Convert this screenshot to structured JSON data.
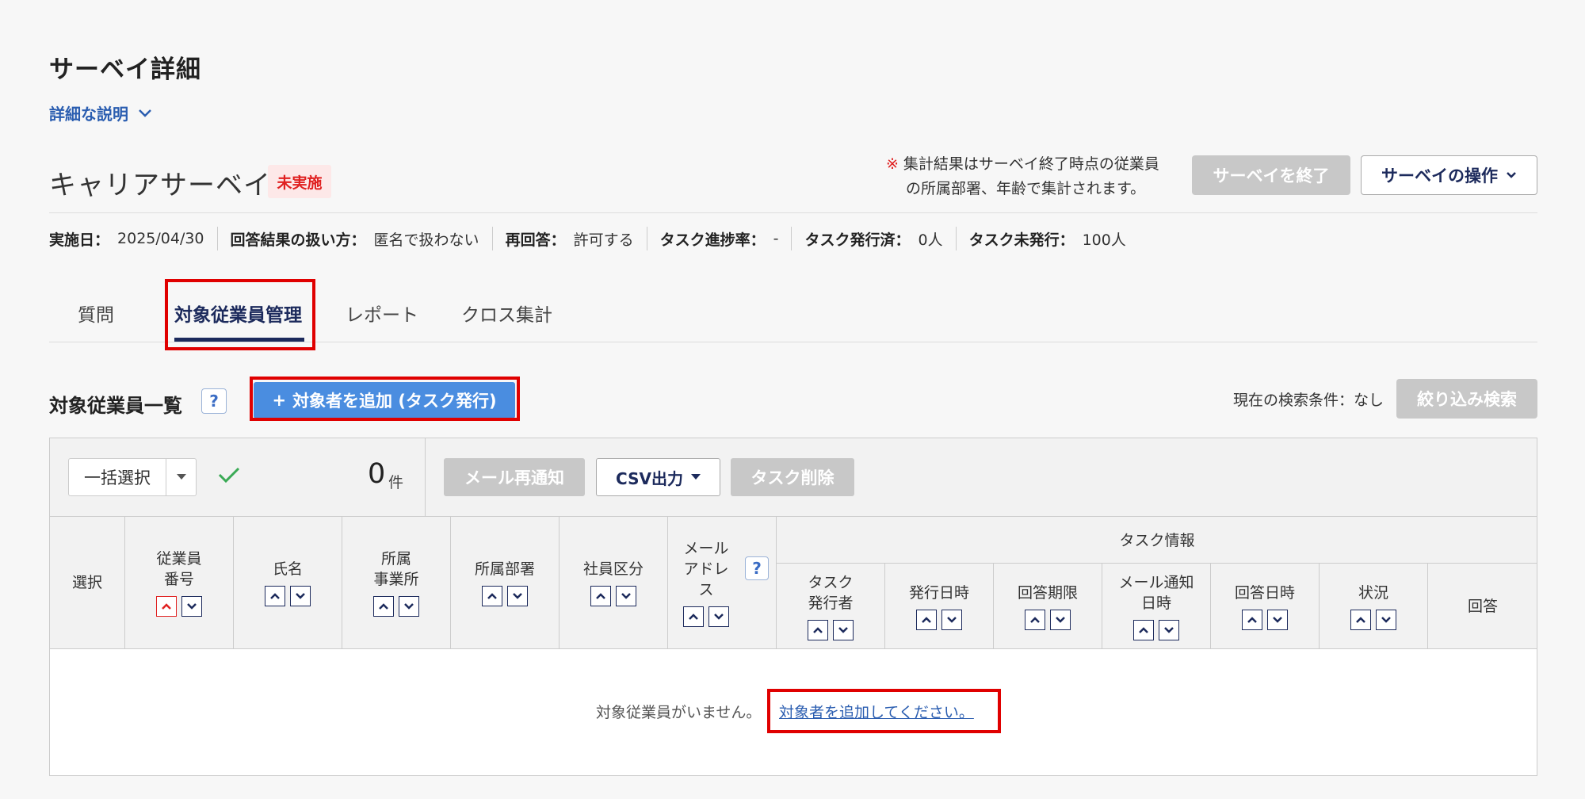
{
  "page": {
    "title": "サーベイ詳細",
    "description_toggle": "詳細な説明"
  },
  "survey": {
    "name": "キャリアサーベイ",
    "status": "未実施",
    "note_mark": "※",
    "note_line1": "集計結果はサーベイ終了時点の従業員",
    "note_line2": "の所属部署、年齢で集計されます。",
    "end_button": "サーベイを終了",
    "ops_button": "サーベイの操作"
  },
  "info": {
    "date_label": "実施日：",
    "date_value": "2025/04/30",
    "handling_label": "回答結果の扱い方：",
    "handling_value": "匿名で扱わない",
    "reanswer_label": "再回答：",
    "reanswer_value": "許可する",
    "progress_label": "タスク進捗率：",
    "progress_value": "-",
    "issued_label": "タスク発行済：",
    "issued_value": "0人",
    "unissued_label": "タスク未発行：",
    "unissued_value": "100人"
  },
  "tabs": {
    "questions": "質問",
    "targets": "対象従業員管理",
    "report": "レポート",
    "cross": "クロス集計"
  },
  "list": {
    "title": "対象従業員一覧",
    "help": "?",
    "add_button": "対象者を追加 (タスク発行)",
    "add_icon": "+",
    "search_condition": "現在の検索条件：なし",
    "filter_button": "絞り込み検索"
  },
  "toolbar": {
    "bulk_select": "一括選択",
    "count": "0",
    "count_unit": "件",
    "mail_button": "メール再通知",
    "csv_button": "CSV出力",
    "delete_button": "タスク削除"
  },
  "table": {
    "select": "選択",
    "emp_no_1": "従業員",
    "emp_no_2": "番号",
    "name": "氏名",
    "office_1": "所属",
    "office_2": "事業所",
    "dept": "所属部署",
    "emp_type": "社員区分",
    "mail_1": "メール",
    "mail_2": "アドレ",
    "mail_3": "ス",
    "task_info": "タスク情報",
    "issuer_1": "タスク",
    "issuer_2": "発行者",
    "issue_date": "発行日時",
    "deadline": "回答期限",
    "notify_1": "メール通知",
    "notify_2": "日時",
    "answer_date": "回答日時",
    "status": "状況",
    "answer": "回答"
  },
  "empty": {
    "message": "対象従業員がいません。",
    "link": "対象者を追加してください。"
  },
  "colors": {
    "highlight": "#e00000",
    "primary": "#4a8de0",
    "navy": "#1c2a5c",
    "link": "#2a5db0",
    "disabled": "#c8c8c8",
    "badge_bg": "#fde8e8",
    "badge_text": "#e02020"
  }
}
